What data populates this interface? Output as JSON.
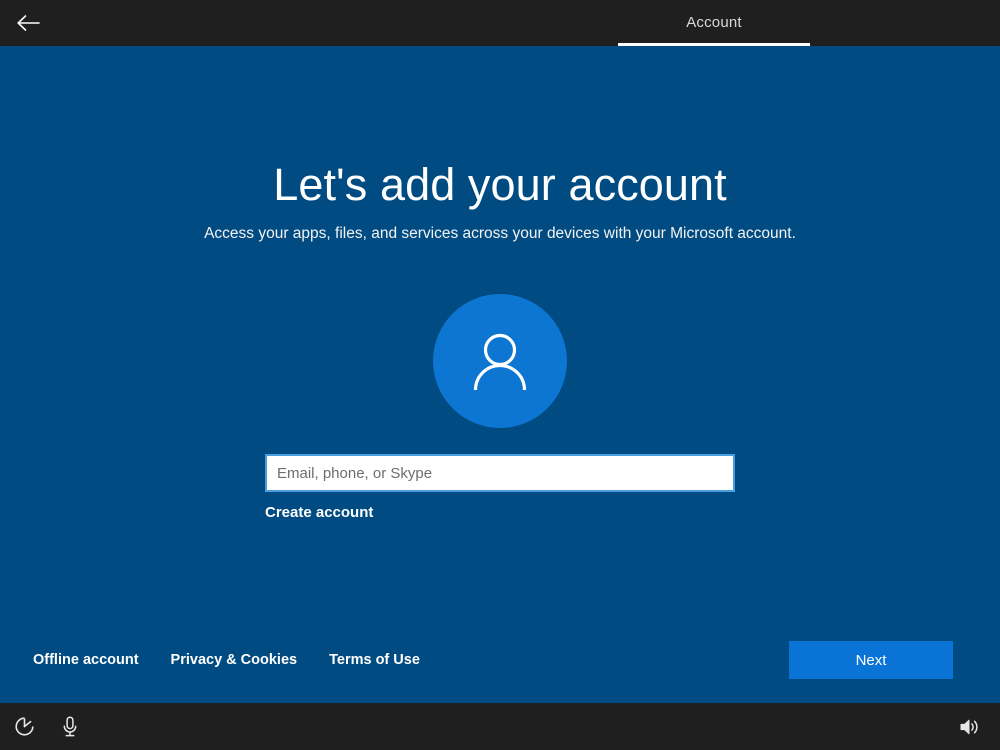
{
  "header": {
    "back_icon": "back-arrow-icon",
    "title": "Account"
  },
  "main": {
    "headline": "Let's add your account",
    "subhead": "Access your apps, files, and services across your devices with your Microsoft account.",
    "avatar_icon": "person-icon",
    "account_input": {
      "placeholder": "Email, phone, or Skype",
      "value": ""
    },
    "create_account_link": "Create account"
  },
  "footer": {
    "links": [
      {
        "label": "Offline account"
      },
      {
        "label": "Privacy & Cookies"
      },
      {
        "label": "Terms of Use"
      }
    ],
    "next_button": "Next"
  },
  "taskbar": {
    "ease_of_access_icon": "ease-of-access-icon",
    "microphone_icon": "microphone-icon",
    "volume_icon": "speaker-volume-icon"
  },
  "colors": {
    "background": "#004b82",
    "chrome": "#1f1f1f",
    "accent": "#0a74d6",
    "avatar": "#0c76d2",
    "input_border": "#4a9fe0"
  }
}
